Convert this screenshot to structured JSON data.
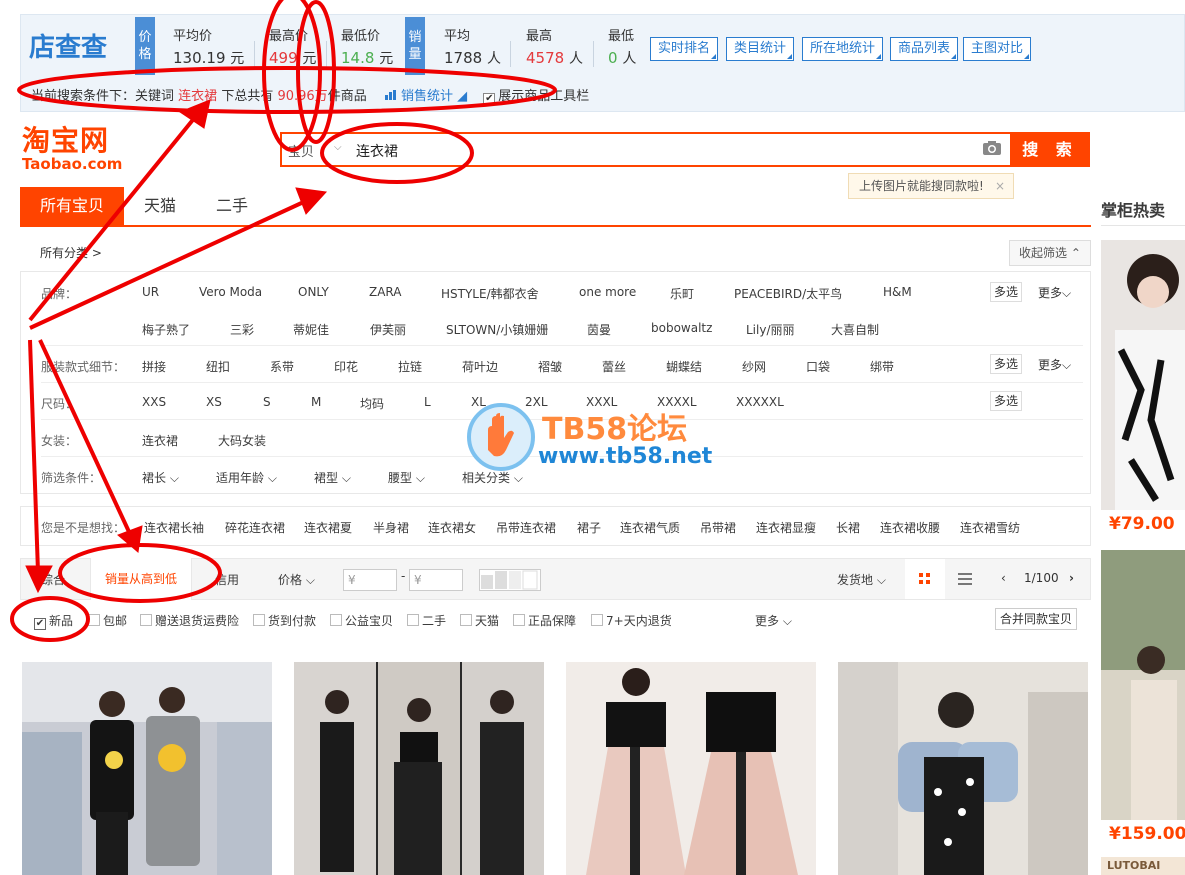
{
  "plugin": {
    "logo_text": "店查查",
    "price_tag": "价格",
    "sales_tag": "销量",
    "stats": [
      {
        "label": "平均价",
        "value": "130.19",
        "unit": "元"
      },
      {
        "label": "最高价",
        "value": "499",
        "unit": "元"
      },
      {
        "label": "最低价",
        "value": "14.8",
        "unit": "元"
      },
      {
        "label": "平均",
        "value": "1788",
        "unit": "人"
      },
      {
        "label": "最高",
        "value": "4578",
        "unit": "人"
      },
      {
        "label": "最低",
        "value": "0",
        "unit": "人"
      }
    ],
    "buttons": [
      "实时排名",
      "类目统计",
      "所在地统计",
      "商品列表",
      "主图对比"
    ],
    "cond_prefix": "当前搜索条件下：关键词",
    "cond_keyword": "连衣裙",
    "cond_mid": "下总共有",
    "cond_count": "90.96万",
    "cond_suffix": "件商品",
    "sales_stats": "销售统计",
    "show_toolbar": "展示商品工具栏"
  },
  "taobao": {
    "logo_cn": "淘宝网",
    "logo_en": "Taobao.com",
    "search_category": "宝贝",
    "search_query": "连衣裙",
    "search_button": "搜 索",
    "image_tip": "上传图片就能搜同款啦!",
    "tabs": [
      "所有宝贝",
      "天猫",
      "二手"
    ],
    "side_title": "掌柜热卖"
  },
  "filters": {
    "all_categories": "所有分类 >",
    "collapse": "收起筛选",
    "multi": "多选",
    "more": "更多",
    "rows": [
      {
        "label": "品牌：",
        "options": [
          "UR",
          "Vero Moda",
          "ONLY",
          "ZARA",
          "HSTYLE/韩都衣舍",
          "one more",
          "乐町",
          "PEACEBIRD/太平鸟",
          "H&M"
        ],
        "options2": [
          "梅子熟了",
          "三彩",
          "蒂妮佳",
          "伊芙丽",
          "SLTOWN/小镇姗姗",
          "茵曼",
          "bobowaltz",
          "Lily/丽丽",
          "大喜自制"
        ]
      },
      {
        "label": "服装款式细节：",
        "options": [
          "拼接",
          "纽扣",
          "系带",
          "印花",
          "拉链",
          "荷叶边",
          "褶皱",
          "蕾丝",
          "蝴蝶结",
          "纱网",
          "口袋",
          "绑带"
        ]
      },
      {
        "label": "尺码：",
        "options": [
          "XXS",
          "XS",
          "S",
          "M",
          "均码",
          "L",
          "XL",
          "2XL",
          "XXXL",
          "XXXXL",
          "XXXXXL"
        ]
      },
      {
        "label": "女装：",
        "options": [
          "连衣裙",
          "大码女装"
        ]
      },
      {
        "label": "筛选条件：",
        "options": [
          "裙长",
          "适用年龄",
          "裙型",
          "腰型",
          "相关分类"
        ]
      }
    ],
    "related_label": "您是不是想找：",
    "related": [
      "连衣裙长袖",
      "碎花连衣裙",
      "连衣裙夏",
      "半身裙",
      "连衣裙女",
      "吊带连衣裙",
      "裙子",
      "连衣裙气质",
      "吊带裙",
      "连衣裙显瘦",
      "长裙",
      "连衣裙收腰",
      "连衣裙雪纺"
    ]
  },
  "sortbar": {
    "items": [
      "综合",
      "销量从高到低",
      "信用",
      "价格"
    ],
    "price_from": "¥",
    "price_to": "¥",
    "location": "发货地",
    "page": "1/100"
  },
  "checkboxes": [
    {
      "label": "新品",
      "checked": true
    },
    {
      "label": "包邮",
      "checked": false
    },
    {
      "label": "赠送退货运费险",
      "checked": false
    },
    {
      "label": "货到付款",
      "checked": false
    },
    {
      "label": "公益宝贝",
      "checked": false
    },
    {
      "label": "二手",
      "checked": false
    },
    {
      "label": "天猫",
      "checked": false
    },
    {
      "label": "正品保障",
      "checked": false
    },
    {
      "label": "7+天内退货",
      "checked": false
    }
  ],
  "more_label": "更多",
  "merge_label": "合并同款宝贝",
  "side_prices": [
    "¥79.00",
    "¥159.00"
  ],
  "side_banner_text": "LUTOBAI",
  "watermark": {
    "title": "TB58论坛",
    "url": "www.tb58.net"
  },
  "colors": {
    "taobao_orange": "#ff4400",
    "plugin_blue": "#2a7ccf",
    "annotation_red": "#ee0000"
  }
}
